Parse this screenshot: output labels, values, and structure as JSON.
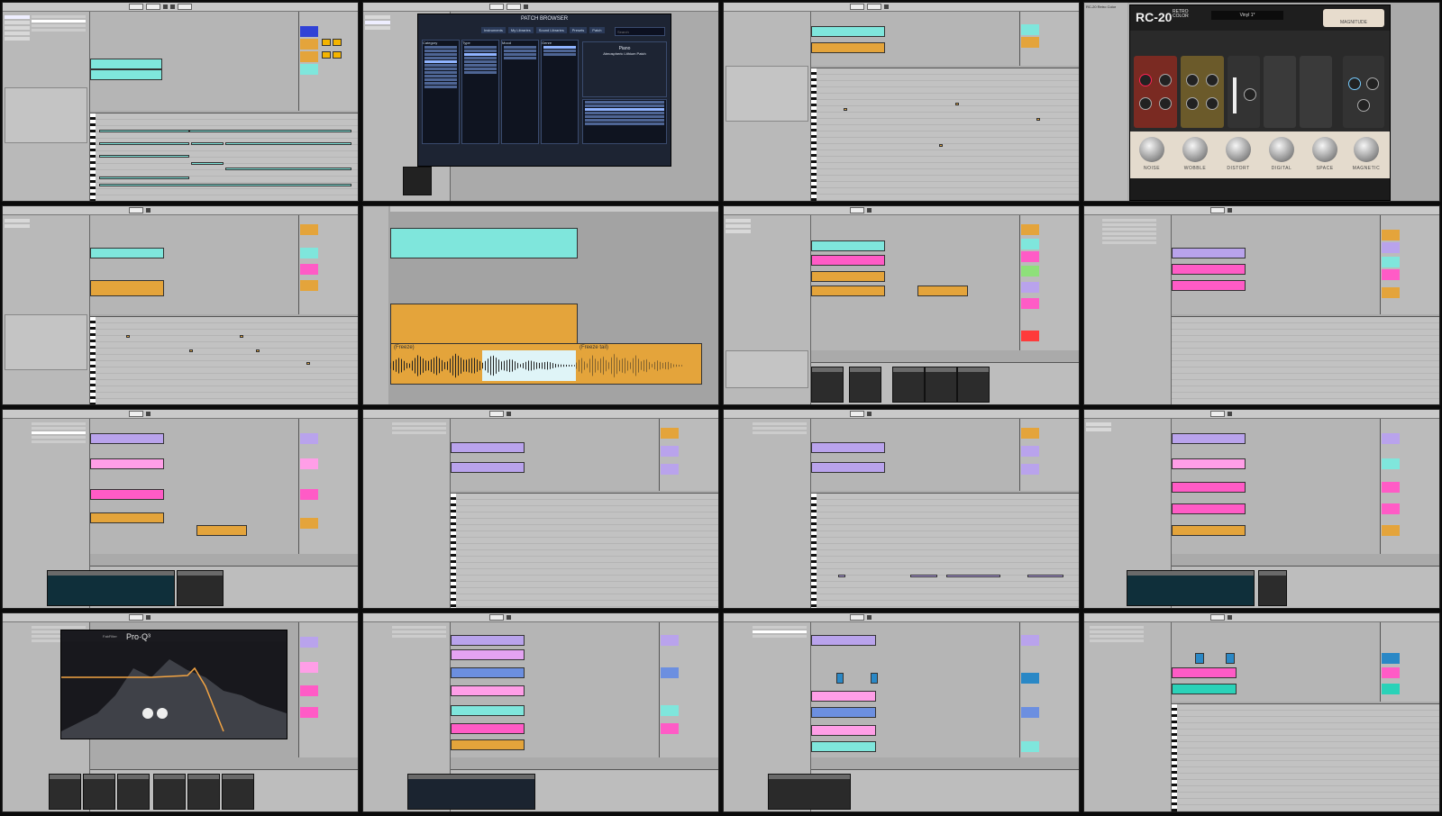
{
  "tiles": {
    "patch_browser": {
      "title": "PATCH BROWSER",
      "search_placeholder": "Search",
      "tabs": [
        "Instruments",
        "My Libraries",
        "Sound Libraries",
        "Presets",
        "Patch"
      ],
      "headers": [
        "Category",
        "Type",
        "Mood",
        "Genre"
      ],
      "preset_name": "Piano",
      "preset_sub": "Atmospheric Lithium Patch"
    },
    "rc20": {
      "logo": "RC-20",
      "logo_sub_1": "RETRO",
      "logo_sub_2": "COLOR",
      "preset": "Vinyl 1*",
      "magnitude": "MAGNITUDE",
      "host_title": "RC-20 Retro Color",
      "modules": [
        "NOISE",
        "WOBBLE",
        "DISTORT",
        "DIGITAL",
        "SPACE",
        "MAGNETIC"
      ]
    },
    "freeze": {
      "label_a": "(Freeze)",
      "label_b": "(Freeze tail)"
    },
    "proq": {
      "brand": "FabFilter",
      "title": "Pro·Q³"
    }
  },
  "colors": {
    "cyan": "#7fe6dc",
    "orange": "#e4a43b",
    "magenta": "#ff5bc6",
    "violet": "#b9a3ec",
    "blue": "#6c8fe0",
    "green": "#8ee07a",
    "red": "#ff3b3b",
    "yellow": "#f4b400"
  }
}
